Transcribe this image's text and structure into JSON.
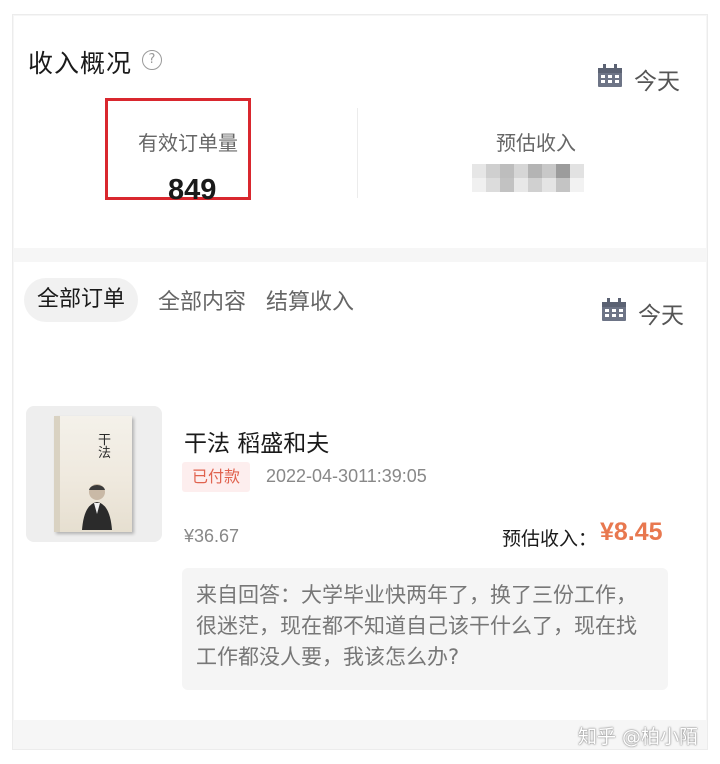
{
  "overview": {
    "title": "收入概况",
    "help_icon": "question-circle-icon",
    "date_icon": "calendar-icon",
    "date_label": "今天",
    "stats": [
      {
        "label": "有效订单量",
        "value": "849"
      },
      {
        "label": "预估收入",
        "value": ""
      }
    ]
  },
  "orders": {
    "tabs": [
      {
        "label": "全部订单",
        "active": true
      },
      {
        "label": "全部内容",
        "active": false
      },
      {
        "label": "结算收入",
        "active": false
      }
    ],
    "date_icon": "calendar-icon",
    "date_label": "今天",
    "items": [
      {
        "cover_icon": "book-cover-image",
        "cover_title": "干法",
        "title": "干法 稻盛和夫",
        "status": "已付款",
        "time": "2022-04-3011:39:05",
        "price": "¥36.67",
        "estimate_label": "预估收入：",
        "estimate_value": "¥8.45",
        "source": "来自回答：大学毕业快两年了，换了三份工作，很迷茫，现在都不知道自己该干什么了，现在找工作都没人要，我该怎么办?"
      }
    ]
  },
  "watermark": "知乎 @柏小陌",
  "colors": {
    "highlight_border": "#d9272e",
    "accent_orange": "#e8784f",
    "badge_bg": "#fdeeee",
    "badge_text": "#e0634f"
  }
}
